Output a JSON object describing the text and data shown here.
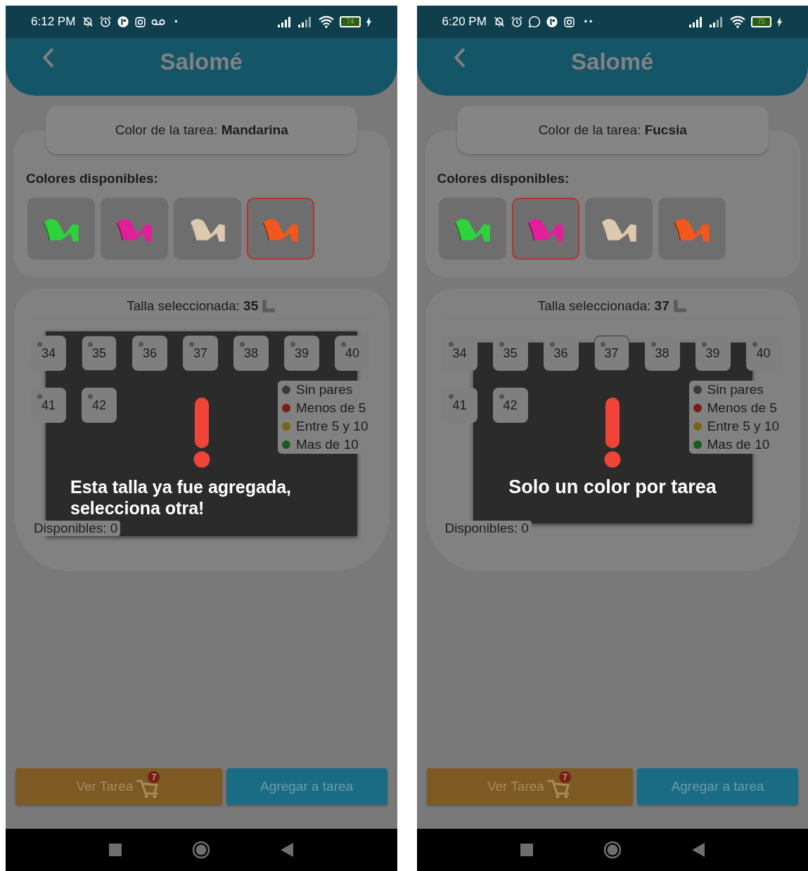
{
  "screens": [
    {
      "status_bar": {
        "time": "6:12 PM",
        "icons": [
          {
            "kind": "bell-off"
          },
          {
            "kind": "alarm"
          },
          {
            "kind": "app"
          },
          {
            "kind": "camera"
          },
          {
            "kind": "voicemail"
          }
        ],
        "more": "•",
        "battery": "74"
      },
      "header": {
        "title": "Salomé"
      },
      "task_color": "Color de la tarea: **Mandarina**",
      "colors_title": "Colores disponibles:",
      "colors": [
        {
          "color": "#2fd13c",
          "selected": false
        },
        {
          "color": "#e0209a",
          "selected": false
        },
        {
          "color": "#dcc9b0",
          "selected": false
        },
        {
          "color": "#f2581e",
          "selected": true
        }
      ],
      "size_title": "Talla seleccionada: **35**",
      "sizes": [
        {
          "label": "34",
          "selected": false
        },
        {
          "label": "35",
          "selected": true
        },
        {
          "label": "36",
          "selected": false
        },
        {
          "label": "37",
          "selected": false
        },
        {
          "label": "38",
          "selected": false
        },
        {
          "label": "39",
          "selected": false
        },
        {
          "label": "40",
          "selected": false
        },
        {
          "label": "41",
          "selected": false
        },
        {
          "label": "42",
          "selected": false
        }
      ],
      "legend": [
        {
          "label": "Sin pares",
          "color": "#3a3a3a"
        },
        {
          "label": "Menos de 5",
          "color": "#7a1d12"
        },
        {
          "label": "Entre 5 y 10",
          "color": "#7a6410"
        },
        {
          "label": "Mas de 10",
          "color": "#1d5a1f"
        }
      ],
      "available": "Disponibles:  0",
      "dialog": {
        "message": "Esta talla ya fue agregada, selecciona otra!",
        "kind": "wrapped"
      },
      "buttons": {
        "view": "Ver Tarea",
        "badge": "7",
        "add": "Agregar a tarea"
      }
    },
    {
      "status_bar": {
        "time": "6:20 PM",
        "icons": [
          {
            "kind": "bell-off"
          },
          {
            "kind": "alarm"
          },
          {
            "kind": "chat"
          },
          {
            "kind": "app"
          },
          {
            "kind": "camera"
          }
        ],
        "more": "••",
        "battery": "75"
      },
      "header": {
        "title": "Salomé"
      },
      "task_color": "Color de la tarea: **Fucsia**",
      "colors_title": "Colores disponibles:",
      "colors": [
        {
          "color": "#2fd13c",
          "selected": false
        },
        {
          "color": "#e0209a",
          "selected": true
        },
        {
          "color": "#dcc9b0",
          "selected": false
        },
        {
          "color": "#f2581e",
          "selected": false
        }
      ],
      "size_title": "Talla seleccionada: **37**",
      "sizes": [
        {
          "label": "34",
          "selected": false
        },
        {
          "label": "35",
          "selected": false
        },
        {
          "label": "36",
          "selected": false
        },
        {
          "label": "37",
          "selected": true
        },
        {
          "label": "38",
          "selected": false
        },
        {
          "label": "39",
          "selected": false
        },
        {
          "label": "40",
          "selected": false
        },
        {
          "label": "41",
          "selected": false
        },
        {
          "label": "42",
          "selected": false
        }
      ],
      "legend": [
        {
          "label": "Sin pares",
          "color": "#3a3a3a"
        },
        {
          "label": "Menos de 5",
          "color": "#7a1d12"
        },
        {
          "label": "Entre 5 y 10",
          "color": "#7a6410"
        },
        {
          "label": "Mas de 10",
          "color": "#1d5a1f"
        }
      ],
      "available": "Disponibles:  0",
      "dialog": {
        "message": "Solo un color por tarea",
        "kind": "single"
      },
      "buttons": {
        "view": "Ver Tarea",
        "badge": "7",
        "add": "Agregar a tarea"
      }
    }
  ]
}
